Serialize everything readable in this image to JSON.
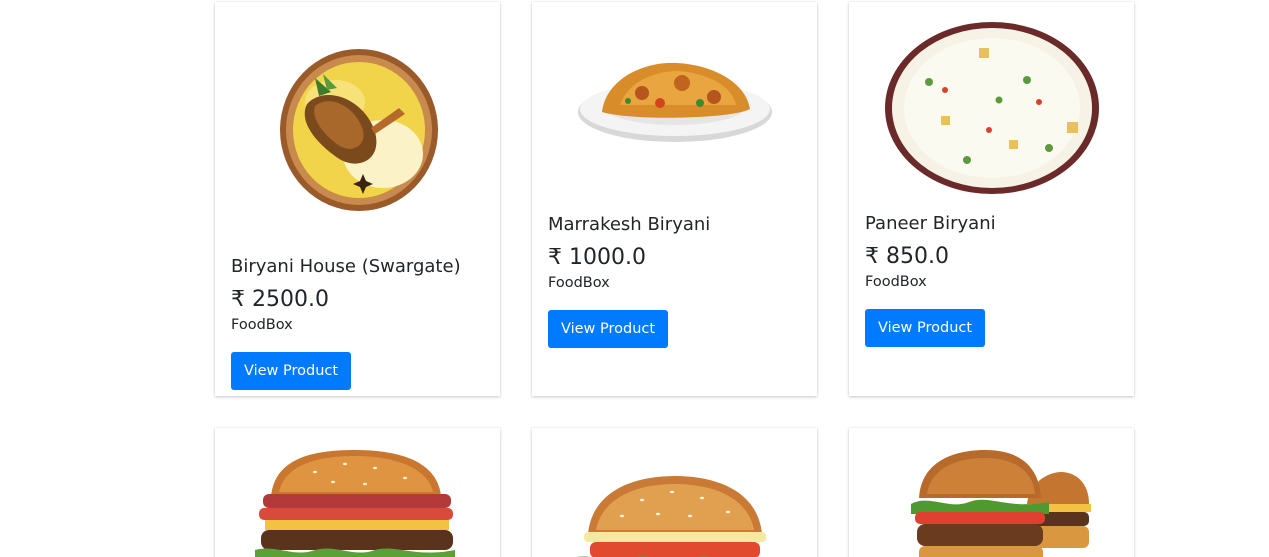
{
  "currency_symbol": "₹",
  "accent_color": "#007bff",
  "products": [
    {
      "name": "Biryani House (Swargate)",
      "price": "₹ 2500.0",
      "brand": "FoodBox",
      "button_label": "View Product",
      "image": "chicken-biryani-bowl"
    },
    {
      "name": "Marrakesh Biryani",
      "price": "₹ 1000.0",
      "brand": "FoodBox",
      "button_label": "View Product",
      "image": "biryani-plate"
    },
    {
      "name": "Paneer Biryani",
      "price": "₹ 850.0",
      "brand": "FoodBox",
      "button_label": "View Product",
      "image": "paneer-rice-plate"
    },
    {
      "image": "bacon-burger"
    },
    {
      "image": "sesame-burger"
    },
    {
      "image": "double-burger"
    }
  ]
}
